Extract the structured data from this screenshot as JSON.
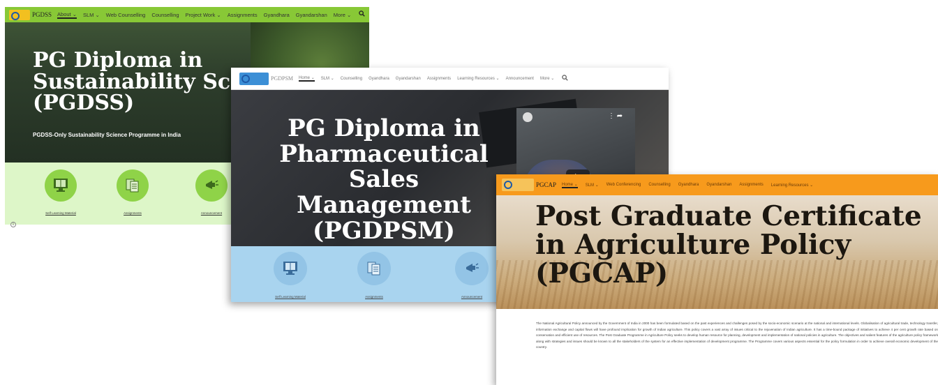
{
  "pgdss": {
    "logo_text": "PGDSS",
    "nav": [
      "About ⌄",
      "SLM ⌄",
      "Web Counselling",
      "Counselling",
      "Project Work ⌄",
      "Assignments",
      "Gyandhara",
      "Gyandarshan",
      "More ⌄"
    ],
    "title": "PG Diploma in Sustainability Science (PGDSS)",
    "subtitle": "PGDSS-Only Sustainability Science Programme in India",
    "cards": [
      "Self Learning Material",
      "Assignments",
      "Announcement"
    ]
  },
  "pgdpsm": {
    "logo_text": "PGDPSM",
    "nav": [
      "Home ⌄",
      "SLM ⌄",
      "Counselling",
      "Gyandhara",
      "Gyandarshan",
      "Assignments",
      "Learning Resources ⌄",
      "Announcement",
      "More ⌄"
    ],
    "title": "PG Diploma in Pharmaceutical Sales Management (PGDPSM)",
    "cards": [
      "Self Learning Material",
      "Assignments",
      "Announcement"
    ]
  },
  "pgcap": {
    "logo_text": "PGCAP",
    "nav": [
      "Home ⌄",
      "SLM ⌄",
      "Web Conferencing",
      "Counselling",
      "Gyandhara",
      "Gyandarshan",
      "Assignments",
      "Learning Resources ⌄"
    ],
    "title": "Post Graduate Certificate in Agriculture Policy (PGCAP)",
    "body": "The National Agricultural Policy announced by the Government of India in 2000 has been formulated based on the past experiences and challenges posed by the socio-economic scenario at the national and international levels. Globalisation of agricultural trade, technology transfer, information exchange and capital flows will have profound implication for growth of Indian agriculture. This policy covers a vast array of issues critical to the rejuvenation of Indian agriculture. It has a time-bound package of initiatives to achieve 4 per cent growth rate based on conservation and efficient use of resources. The Post Graduate Programme in Agriculture Policy seeks to develop human resource for planning, development and implementation of national policies in agriculture. The objectives and salient features of the agriculture policy framework along with strategies and issues should be known to all the stakeholders of the system for an effective implementation of development programme. The Programme covers various aspects essential for the policy formulation in order to achieve overall economic development of the country."
  },
  "colors": {
    "pgdss_nav": "#88c836",
    "pgdpsm_cards": "#a9d4ef",
    "pgcap_nav": "#f79a1c"
  }
}
